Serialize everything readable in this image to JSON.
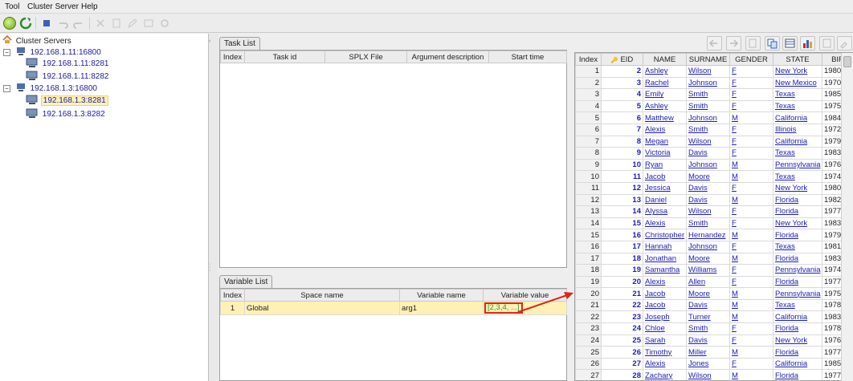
{
  "menu": {
    "tool": "Tool",
    "cluster_server": "Cluster Server",
    "help": "Help"
  },
  "tree": {
    "root": "Cluster Servers",
    "nodes": [
      {
        "label": "192.168.1.11:16800",
        "children": [
          "192.168.1.11:8281",
          "192.168.1.11:8282"
        ]
      },
      {
        "label": "192.168.1.3:16800",
        "children": [
          "192.168.1.3:8281",
          "192.168.1.3:8282"
        ]
      }
    ]
  },
  "task_list": {
    "tab": "Task List",
    "columns": [
      "Index",
      "Task id",
      "SPLX File",
      "Argument description",
      "Start time"
    ]
  },
  "variable_list": {
    "tab": "Variable List",
    "columns": [
      "Index",
      "Space name",
      "Variable name",
      "Variable value"
    ],
    "rows": [
      {
        "index": "1",
        "space": "Global",
        "name": "arg1",
        "value": "[2,3,4, ...]"
      }
    ]
  },
  "data_table": {
    "columns": [
      "Index",
      "EID",
      "NAME",
      "SURNAME",
      "GENDER",
      "STATE",
      "BIR"
    ],
    "rows": [
      [
        "1",
        "2",
        "Ashley",
        "Wilson",
        "F",
        "New York",
        "1980"
      ],
      [
        "2",
        "3",
        "Rachel",
        "Johnson",
        "F",
        "New Mexico",
        "1970"
      ],
      [
        "3",
        "4",
        "Emily",
        "Smith",
        "F",
        "Texas",
        "1985"
      ],
      [
        "4",
        "5",
        "Ashley",
        "Smith",
        "F",
        "Texas",
        "1975"
      ],
      [
        "5",
        "6",
        "Matthew",
        "Johnson",
        "M",
        "California",
        "1984"
      ],
      [
        "6",
        "7",
        "Alexis",
        "Smith",
        "F",
        "Illinois",
        "1972"
      ],
      [
        "7",
        "8",
        "Megan",
        "Wilson",
        "F",
        "California",
        "1979"
      ],
      [
        "8",
        "9",
        "Victoria",
        "Davis",
        "F",
        "Texas",
        "1983"
      ],
      [
        "9",
        "10",
        "Ryan",
        "Johnson",
        "M",
        "Pennsylvania",
        "1976"
      ],
      [
        "10",
        "11",
        "Jacob",
        "Moore",
        "M",
        "Texas",
        "1974"
      ],
      [
        "11",
        "12",
        "Jessica",
        "Davis",
        "F",
        "New York",
        "1980"
      ],
      [
        "12",
        "13",
        "Daniel",
        "Davis",
        "M",
        "Florida",
        "1982"
      ],
      [
        "13",
        "14",
        "Alyssa",
        "Wilson",
        "F",
        "Florida",
        "1977"
      ],
      [
        "14",
        "15",
        "Alexis",
        "Smith",
        "F",
        "New York",
        "1983"
      ],
      [
        "15",
        "16",
        "Christopher",
        "Hernandez",
        "M",
        "Florida",
        "1979"
      ],
      [
        "16",
        "17",
        "Hannah",
        "Johnson",
        "F",
        "Texas",
        "1981"
      ],
      [
        "17",
        "18",
        "Jonathan",
        "Moore",
        "M",
        "Florida",
        "1983"
      ],
      [
        "18",
        "19",
        "Samantha",
        "Williams",
        "F",
        "Pennsylvania",
        "1974"
      ],
      [
        "19",
        "20",
        "Alexis",
        "Allen",
        "F",
        "Florida",
        "1977"
      ],
      [
        "20",
        "21",
        "Jacob",
        "Moore",
        "M",
        "Pennsylvania",
        "1975"
      ],
      [
        "21",
        "22",
        "Jacob",
        "Davis",
        "M",
        "Texas",
        "1978"
      ],
      [
        "22",
        "23",
        "Joseph",
        "Turner",
        "M",
        "California",
        "1983"
      ],
      [
        "23",
        "24",
        "Chloe",
        "Smith",
        "F",
        "Florida",
        "1978"
      ],
      [
        "24",
        "25",
        "Sarah",
        "Davis",
        "F",
        "New York",
        "1976"
      ],
      [
        "25",
        "26",
        "Timothy",
        "Miller",
        "M",
        "Florida",
        "1977"
      ],
      [
        "26",
        "27",
        "Alexis",
        "Jones",
        "F",
        "California",
        "1985"
      ],
      [
        "27",
        "28",
        "Zachary",
        "Wilson",
        "M",
        "Florida",
        "1977"
      ]
    ]
  },
  "colors": {
    "highlight_row": "#fff1b5",
    "annotation_red": "#e0241b",
    "link_blue": "#1d1db5",
    "value_green": "#2e9b2e"
  }
}
